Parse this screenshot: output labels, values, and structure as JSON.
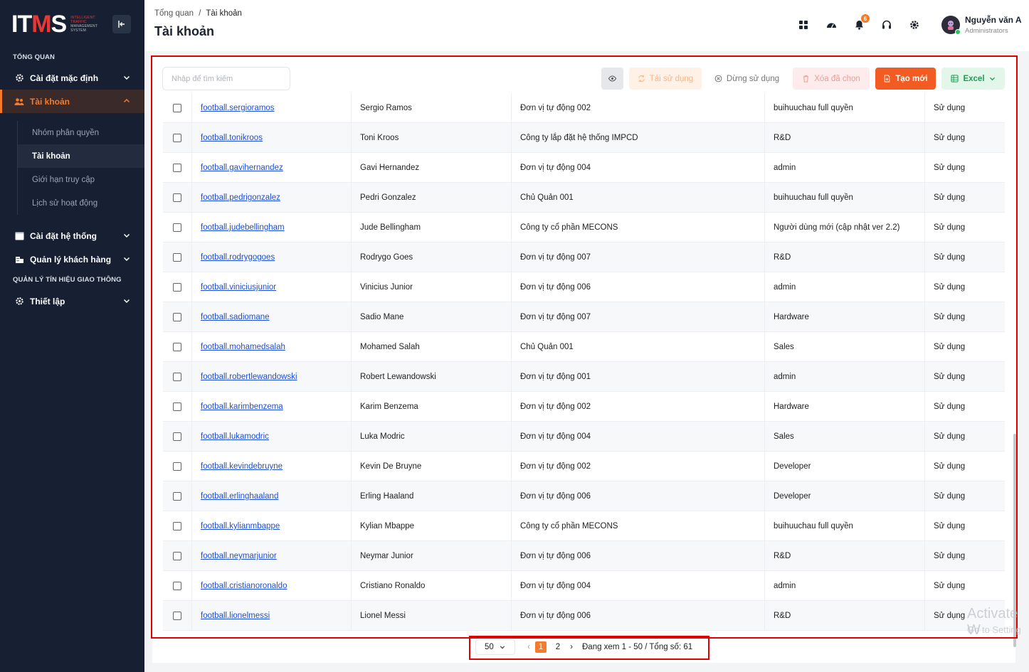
{
  "brand": {
    "logo_text_a": "IT",
    "logo_text_b": "M",
    "logo_text_c": "S",
    "logo_sub_1": "INTELLIGENT",
    "logo_sub_2": "TRAFFIC",
    "logo_sub_3": "MANAGEMENT",
    "logo_sub_4": "SYSTEM",
    "accent": "#f47a2c"
  },
  "sidebar": {
    "section_overview": "TỔNG QUAN",
    "item_default_settings": "Cài đặt mặc định",
    "item_accounts": "Tài khoản",
    "sub_permission_groups": "Nhóm phân quyền",
    "sub_accounts": "Tài khoản",
    "sub_access_limits": "Giới hạn truy cập",
    "sub_activity_log": "Lịch sử hoạt động",
    "item_system_settings": "Cài đặt hệ thống",
    "item_customer_mgmt": "Quản lý khách hàng",
    "section_signal": "QUẢN LÝ TÍN HIỆU GIAO THÔNG",
    "item_setup": "Thiết lập"
  },
  "header": {
    "crumb_root": "Tổng quan",
    "crumb_sep": "/",
    "crumb_current": "Tài khoản",
    "title": "Tài khoản",
    "notif_count": "6",
    "user_name": "Nguyễn văn A",
    "user_role": "Administrators"
  },
  "toolbar": {
    "search_placeholder": "Nhập để tìm kiếm",
    "reuse_label": "Tái sử dụng",
    "stop_label": "Dừng sử dụng",
    "delete_label": "Xóa đã chọn",
    "create_label": "Tạo mới",
    "excel_label": "Excel"
  },
  "rows": [
    {
      "username": "football.sergioramos",
      "name": "Sergio Ramos",
      "unit": "Đơn vị tự động 002",
      "group": "buihuuchau full quyền",
      "status": "Sử dụng"
    },
    {
      "username": "football.tonikroos",
      "name": "Toni Kroos",
      "unit": "Công ty lắp đặt hệ thống IMPCD",
      "group": "R&D",
      "status": "Sử dụng"
    },
    {
      "username": "football.gavihernandez",
      "name": "Gavi Hernandez",
      "unit": "Đơn vị tự động 004",
      "group": "admin",
      "status": "Sử dụng"
    },
    {
      "username": "football.pedrigonzalez",
      "name": "Pedri Gonzalez",
      "unit": "Chủ Quản 001",
      "group": "buihuuchau full quyền",
      "status": "Sử dụng"
    },
    {
      "username": "football.judebellingham",
      "name": "Jude Bellingham",
      "unit": "Công ty cổ phần MECONS",
      "group": "Người dùng mới (cập nhật ver 2.2)",
      "status": "Sử dụng"
    },
    {
      "username": "football.rodrygogoes",
      "name": "Rodrygo Goes",
      "unit": "Đơn vị tự động 007",
      "group": "R&D",
      "status": "Sử dụng"
    },
    {
      "username": "football.viniciusjunior",
      "name": "Vinicius Junior",
      "unit": "Đơn vị tự động 006",
      "group": "admin",
      "status": "Sử dụng"
    },
    {
      "username": "football.sadiomane",
      "name": "Sadio Mane",
      "unit": "Đơn vị tự động 007",
      "group": "Hardware",
      "status": "Sử dụng"
    },
    {
      "username": "football.mohamedsalah",
      "name": "Mohamed Salah",
      "unit": "Chủ Quản 001",
      "group": "Sales",
      "status": "Sử dụng"
    },
    {
      "username": "football.robertlewandowski",
      "name": "Robert Lewandowski",
      "unit": "Đơn vị tự động 001",
      "group": "admin",
      "status": "Sử dụng"
    },
    {
      "username": "football.karimbenzema",
      "name": "Karim Benzema",
      "unit": "Đơn vị tự động 002",
      "group": "Hardware",
      "status": "Sử dụng"
    },
    {
      "username": "football.lukamodric",
      "name": "Luka Modric",
      "unit": "Đơn vị tự động 004",
      "group": "Sales",
      "status": "Sử dụng"
    },
    {
      "username": "football.kevindebruyne",
      "name": "Kevin De Bruyne",
      "unit": "Đơn vị tự động 002",
      "group": "Developer",
      "status": "Sử dụng"
    },
    {
      "username": "football.erlinghaaland",
      "name": "Erling Haaland",
      "unit": "Đơn vị tự động 006",
      "group": "Developer",
      "status": "Sử dụng"
    },
    {
      "username": "football.kylianmbappe",
      "name": "Kylian Mbappe",
      "unit": "Công ty cổ phần MECONS",
      "group": "buihuuchau full quyền",
      "status": "Sử dụng"
    },
    {
      "username": "football.neymarjunior",
      "name": "Neymar Junior",
      "unit": "Đơn vị tự động 006",
      "group": "R&D",
      "status": "Sử dụng"
    },
    {
      "username": "football.cristianoronaldo",
      "name": "Cristiano Ronaldo",
      "unit": "Đơn vị tự động 004",
      "group": "admin",
      "status": "Sử dụng"
    },
    {
      "username": "football.lionelmessi",
      "name": "Lionel Messi",
      "unit": "Đơn vị tự động 006",
      "group": "R&D",
      "status": "Sử dụng"
    }
  ],
  "pagination": {
    "page_size": "50",
    "page_1": "1",
    "page_2": "2",
    "summary": "Đang xem 1 - 50 / Tổng số: 61"
  },
  "watermark": {
    "line1": "Activate W",
    "line2": "Go to Setting"
  }
}
